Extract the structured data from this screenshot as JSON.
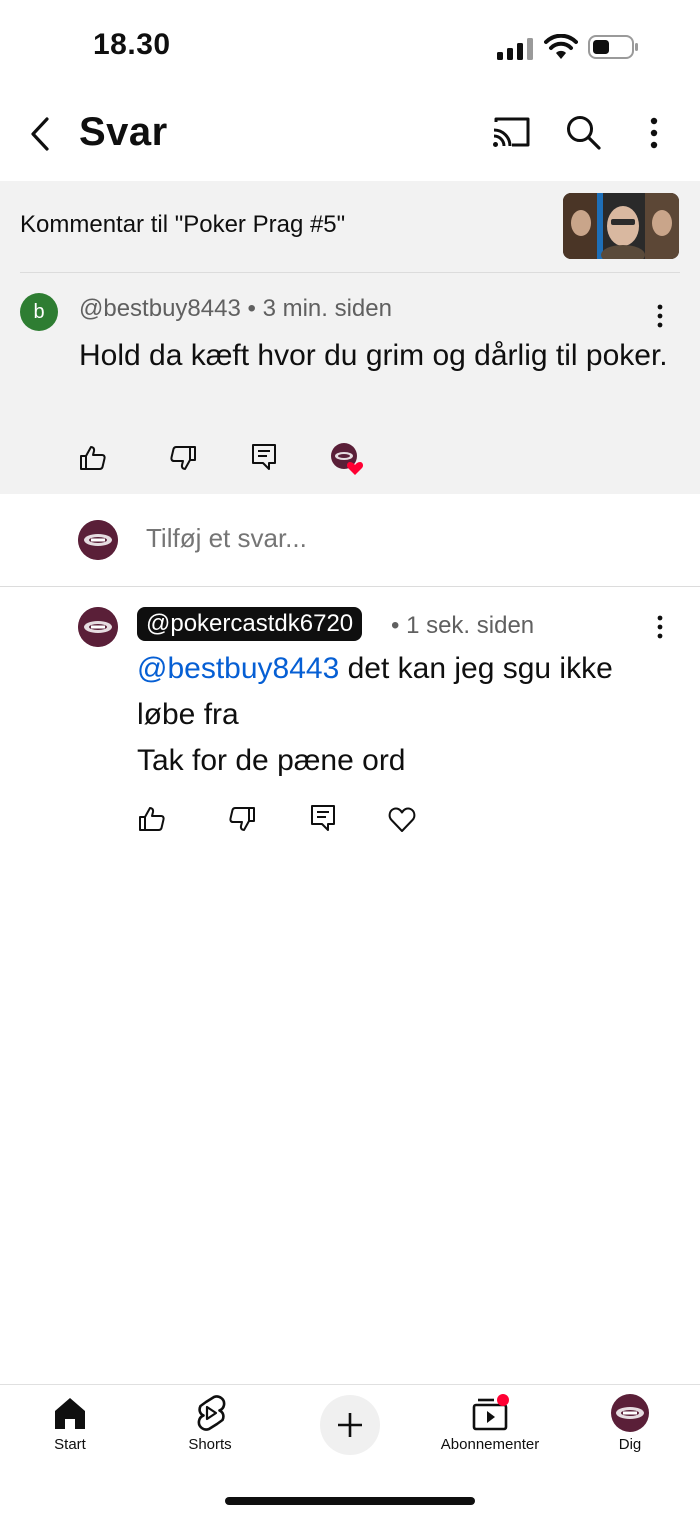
{
  "status_bar": {
    "time": "18.30"
  },
  "header": {
    "title": "Svar"
  },
  "context": {
    "title": "Kommentar til \"Poker Prag #5\""
  },
  "comment": {
    "avatar_letter": "b",
    "author": "@bestbuy8443",
    "separator": " • ",
    "time": "3 min. siden",
    "text": "Hold da kæft hvor du grim og dårlig til poker."
  },
  "reply_input": {
    "placeholder": "Tilføj et svar..."
  },
  "reply": {
    "author": "@pokercastdk6720",
    "meta": "• 1 sek. siden",
    "mention": "@bestbuy8443",
    "text_line1": " det kan jeg sgu ikke løbe fra",
    "text_line2": "Tak for de pæne ord"
  },
  "bottom_nav": {
    "start": "Start",
    "shorts": "Shorts",
    "subscriptions": "Abonnementer",
    "you": "Dig"
  },
  "colors": {
    "mention": "#065fd4",
    "avatar_b": "#2e7d32",
    "channel_avatar": "#5a1f38",
    "notification_dot": "#ff0033",
    "heart": "#ff0033"
  },
  "icons": {
    "header": [
      "back-arrow-icon",
      "cast-icon",
      "search-icon",
      "more-vertical-icon"
    ],
    "actions": [
      "thumbs-up-icon",
      "thumbs-down-icon",
      "reply-icon",
      "heart-icon"
    ],
    "nav": [
      "home-icon",
      "shorts-icon",
      "plus-icon",
      "subscriptions-icon",
      "avatar"
    ]
  }
}
